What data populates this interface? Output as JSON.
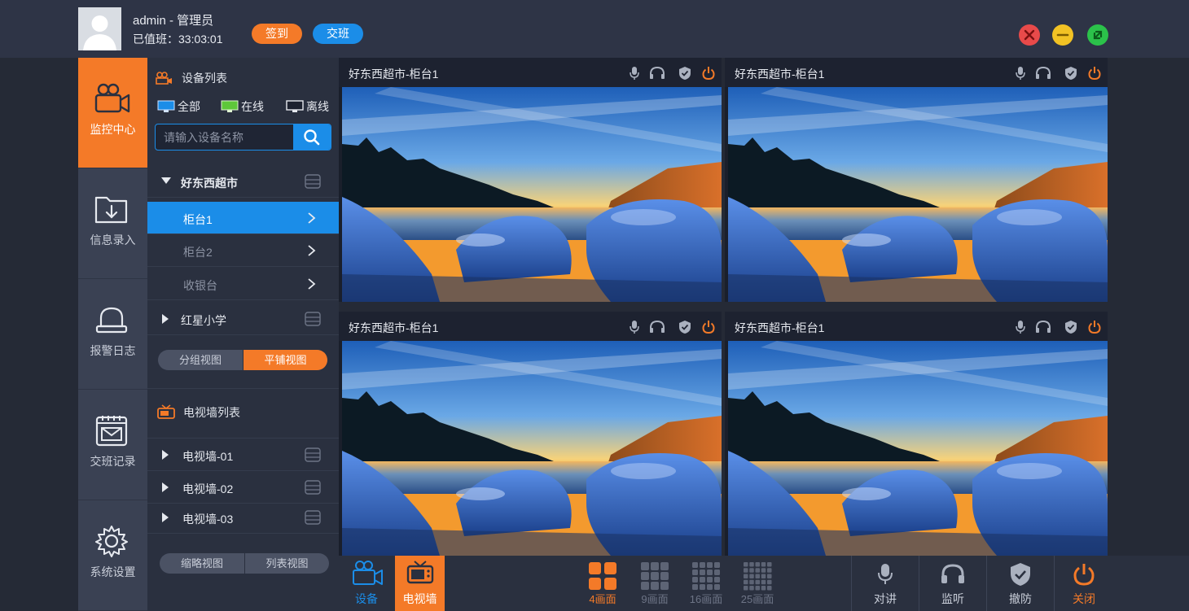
{
  "header": {
    "user_name": "admin - 管理员",
    "shift_label": "已值班：",
    "shift_time": "33:03:01",
    "signin_label": "签到",
    "handover_label": "交班"
  },
  "nav": [
    {
      "label": "监控中心",
      "icon": "camera-icon"
    },
    {
      "label": "信息录入",
      "icon": "folder-download-icon"
    },
    {
      "label": "报警日志",
      "icon": "bell-icon"
    },
    {
      "label": "交班记录",
      "icon": "calendar-mail-icon"
    },
    {
      "label": "系统设置",
      "icon": "gear-icon"
    }
  ],
  "device_panel": {
    "title": "设备列表",
    "filters": [
      "全部",
      "在线",
      "离线"
    ],
    "search_placeholder": "请输入设备名称",
    "groups": [
      {
        "name": "好东西超市",
        "expanded": true,
        "children": [
          "柜台1",
          "柜台2",
          "收银台"
        ]
      },
      {
        "name": "红星小学",
        "expanded": false
      }
    ],
    "view_toggle": [
      "分组视图",
      "平铺视图"
    ],
    "tvwall_title": "电视墙列表",
    "tvwalls": [
      "电视墙-01",
      "电视墙-02",
      "电视墙-03"
    ],
    "tvwall_toggle": [
      "缩略视图",
      "列表视图"
    ]
  },
  "tiles": [
    {
      "title": "好东西超市-柜台1"
    },
    {
      "title": "好东西超市-柜台1"
    },
    {
      "title": "好东西超市-柜台1"
    },
    {
      "title": "好东西超市-柜台1"
    }
  ],
  "toolbar": {
    "device_label": "设备",
    "tvwall_label": "电视墙",
    "grid_options": [
      "4画面",
      "9画面",
      "16画面",
      "25画面"
    ],
    "selected_grid": "4画面",
    "actions": [
      "对讲",
      "监听",
      "撤防",
      "关闭"
    ]
  },
  "colors": {
    "accent": "#f47a28",
    "primary": "#1b8de8",
    "bg": "#252a36"
  }
}
